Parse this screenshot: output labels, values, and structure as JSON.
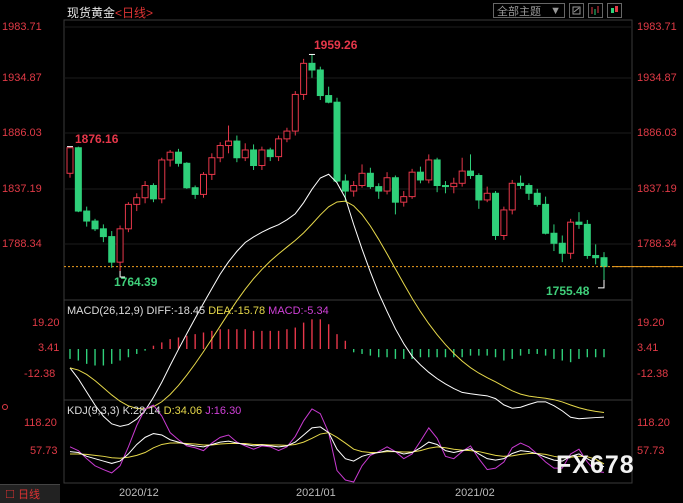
{
  "title": {
    "name": "现货黄金",
    "period": "<日线>"
  },
  "toolbar": {
    "theme_label": "全部主题",
    "theme_arrow": "▼"
  },
  "main_axis": {
    "ticks": [
      "1983.71",
      "1934.87",
      "1886.03",
      "1837.19",
      "1788.34"
    ]
  },
  "annotations": {
    "high": "1959.26",
    "left_high": "1876.16",
    "low1": "1764.39",
    "low2": "1755.48"
  },
  "macd": {
    "label": "MACD(26,12,9)",
    "diff": "DIFF:-18.45",
    "dea": "DEA:-15.78",
    "macd": "MACD:-5.34",
    "ticks": [
      "19.20",
      "3.41",
      "-12.38"
    ]
  },
  "kdj": {
    "label": "KDJ(9,3,3)",
    "k": "K:28.14",
    "d": "D:34.06",
    "j": "J:16.30",
    "ticks": [
      "118.20",
      "57.73"
    ]
  },
  "dates": [
    "2020/12",
    "2021/01",
    "2021/02"
  ],
  "tab": {
    "label": "日线"
  },
  "watermark": "FX678",
  "colors": {
    "up": "#e6374a",
    "down": "#2fd07a",
    "bg": "#000000",
    "grid": "#3a3a3a",
    "last": "#f0a020"
  },
  "chart_data": {
    "type": "candlestick",
    "ylim": [
      1740,
      2000
    ],
    "candles": [
      [
        1852,
        1876,
        1848,
        1875
      ],
      [
        1875,
        1876,
        1817,
        1818
      ],
      [
        1818,
        1822,
        1804,
        1809
      ],
      [
        1809,
        1811,
        1800,
        1802
      ],
      [
        1802,
        1806,
        1790,
        1795
      ],
      [
        1795,
        1800,
        1767,
        1772
      ],
      [
        1772,
        1805,
        1764,
        1802
      ],
      [
        1802,
        1826,
        1799,
        1824
      ],
      [
        1824,
        1834,
        1818,
        1830
      ],
      [
        1830,
        1845,
        1825,
        1841
      ],
      [
        1841,
        1843,
        1826,
        1829
      ],
      [
        1829,
        1866,
        1825,
        1864
      ],
      [
        1864,
        1873,
        1858,
        1871
      ],
      [
        1871,
        1874,
        1858,
        1861
      ],
      [
        1861,
        1862,
        1838,
        1839
      ],
      [
        1839,
        1841,
        1829,
        1833
      ],
      [
        1833,
        1853,
        1830,
        1851
      ],
      [
        1851,
        1870,
        1846,
        1866
      ],
      [
        1866,
        1880,
        1862,
        1877
      ],
      [
        1877,
        1895,
        1870,
        1881
      ],
      [
        1881,
        1886,
        1862,
        1866
      ],
      [
        1866,
        1879,
        1863,
        1873
      ],
      [
        1873,
        1878,
        1855,
        1859
      ],
      [
        1859,
        1876,
        1855,
        1873
      ],
      [
        1873,
        1875,
        1863,
        1867
      ],
      [
        1867,
        1886,
        1863,
        1883
      ],
      [
        1883,
        1893,
        1880,
        1890
      ],
      [
        1890,
        1926,
        1886,
        1923
      ],
      [
        1923,
        1955,
        1918,
        1951
      ],
      [
        1951,
        1959,
        1938,
        1945
      ],
      [
        1945,
        1948,
        1918,
        1922
      ],
      [
        1922,
        1930,
        1915,
        1916
      ],
      [
        1916,
        1920,
        1843,
        1845
      ],
      [
        1845,
        1851,
        1826,
        1836
      ],
      [
        1836,
        1845,
        1831,
        1841
      ],
      [
        1841,
        1860,
        1839,
        1852
      ],
      [
        1852,
        1857,
        1838,
        1840
      ],
      [
        1840,
        1843,
        1829,
        1836
      ],
      [
        1836,
        1853,
        1833,
        1848
      ],
      [
        1848,
        1850,
        1815,
        1826
      ],
      [
        1826,
        1836,
        1822,
        1831
      ],
      [
        1831,
        1856,
        1829,
        1853
      ],
      [
        1853,
        1858,
        1843,
        1846
      ],
      [
        1846,
        1869,
        1843,
        1864
      ],
      [
        1864,
        1866,
        1835,
        1841
      ],
      [
        1841,
        1845,
        1834,
        1840
      ],
      [
        1840,
        1848,
        1834,
        1843
      ],
      [
        1843,
        1866,
        1840,
        1854
      ],
      [
        1854,
        1869,
        1847,
        1850
      ],
      [
        1850,
        1852,
        1820,
        1828
      ],
      [
        1828,
        1840,
        1826,
        1834
      ],
      [
        1834,
        1836,
        1792,
        1796
      ],
      [
        1796,
        1822,
        1792,
        1819
      ],
      [
        1819,
        1846,
        1815,
        1843
      ],
      [
        1843,
        1850,
        1838,
        1841
      ],
      [
        1841,
        1843,
        1828,
        1834
      ],
      [
        1834,
        1838,
        1822,
        1824
      ],
      [
        1824,
        1831,
        1797,
        1798
      ],
      [
        1798,
        1806,
        1782,
        1789
      ],
      [
        1789,
        1796,
        1772,
        1780
      ],
      [
        1780,
        1811,
        1775,
        1808
      ],
      [
        1808,
        1817,
        1802,
        1806
      ],
      [
        1806,
        1810,
        1775,
        1778
      ],
      [
        1778,
        1788,
        1770,
        1776
      ],
      [
        1776,
        1781,
        1756,
        1768
      ]
    ],
    "macd_hist": [
      -6,
      -7,
      -9,
      -10,
      -10,
      -9,
      -7,
      -5,
      -3,
      -1,
      2,
      4,
      6,
      7,
      8,
      9,
      10,
      11,
      12,
      12,
      12,
      12,
      11,
      11,
      11,
      11,
      12,
      13,
      16,
      18,
      18,
      15,
      9,
      5,
      -2,
      -3,
      -4,
      -5,
      -5,
      -6,
      -6,
      -6,
      -5,
      -5,
      -5,
      -5,
      -5,
      -5,
      -4,
      -4,
      -4,
      -5,
      -7,
      -6,
      -4,
      -3,
      -3,
      -4,
      -6,
      -7,
      -8,
      -6,
      -5,
      -5,
      -5
    ],
    "kdj": {
      "k": [
        60,
        58,
        50,
        45,
        40,
        35,
        40,
        55,
        75,
        90,
        98,
        95,
        85,
        80,
        75,
        72,
        70,
        75,
        80,
        82,
        78,
        75,
        72,
        74,
        72,
        70,
        72,
        80,
        95,
        110,
        112,
        100,
        65,
        45,
        40,
        50,
        55,
        58,
        62,
        60,
        55,
        58,
        68,
        80,
        75,
        62,
        58,
        62,
        66,
        55,
        45,
        42,
        45,
        56,
        62,
        60,
        55,
        48,
        42,
        40,
        50,
        55,
        45,
        35,
        28
      ],
      "d": [
        55,
        55,
        54,
        52,
        50,
        47,
        46,
        48,
        52,
        58,
        68,
        75,
        78,
        78,
        77,
        76,
        74,
        74,
        76,
        77,
        77,
        77,
        75,
        75,
        74,
        74,
        73,
        75,
        80,
        88,
        97,
        100,
        90,
        78,
        65,
        60,
        58,
        58,
        60,
        60,
        59,
        59,
        62,
        67,
        70,
        68,
        65,
        63,
        62,
        60,
        56,
        52,
        50,
        51,
        54,
        56,
        56,
        54,
        50,
        47,
        48,
        50,
        49,
        44,
        34
      ],
      "j": [
        70,
        62,
        45,
        30,
        22,
        15,
        30,
        70,
        115,
        150,
        158,
        135,
        100,
        85,
        72,
        68,
        62,
        78,
        90,
        95,
        80,
        72,
        65,
        72,
        70,
        62,
        70,
        92,
        125,
        150,
        140,
        100,
        20,
        0,
        -5,
        30,
        52,
        60,
        70,
        60,
        45,
        55,
        82,
        110,
        88,
        50,
        45,
        60,
        72,
        45,
        22,
        25,
        38,
        68,
        78,
        70,
        55,
        38,
        25,
        25,
        55,
        65,
        38,
        18,
        16
      ]
    }
  }
}
